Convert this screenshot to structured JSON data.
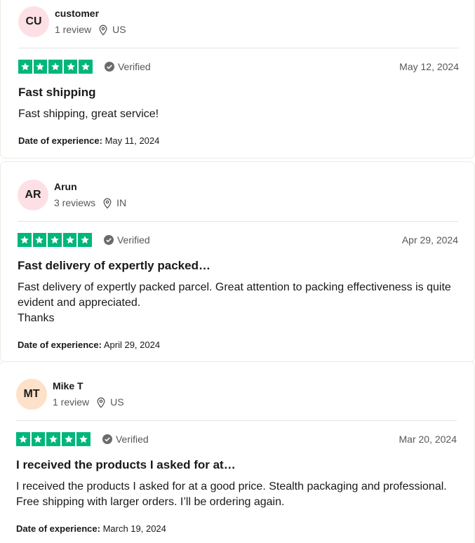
{
  "reviews": [
    {
      "initials": "CU",
      "avatar_color": "#fde0e6",
      "name": "customer",
      "review_count": "1 review",
      "country": "US",
      "verified_label": "Verified",
      "date": "May 12, 2024",
      "rating": 5,
      "title": "Fast shipping",
      "body": "Fast shipping, great service!",
      "experience_label": "Date of experience:",
      "experience_date": "May 11, 2024"
    },
    {
      "initials": "AR",
      "avatar_color": "#fde0e6",
      "name": "Arun",
      "review_count": "3 reviews",
      "country": "IN",
      "verified_label": "Verified",
      "date": "Apr 29, 2024",
      "rating": 5,
      "title": "Fast delivery of expertly packed…",
      "body": "Fast delivery of expertly packed parcel. Great attention to packing effectiveness is quite evident and appreciated.\nThanks",
      "experience_label": "Date of experience:",
      "experience_date": "April 29, 2024"
    },
    {
      "initials": "MT",
      "avatar_color": "#fde1c8",
      "name": "Mike T",
      "review_count": "1 review",
      "country": "US",
      "verified_label": "Verified",
      "date": "Mar 20, 2024",
      "rating": 5,
      "title": "I received the products I asked for at…",
      "body": "I received the products I asked for at a good price. Stealth packaging and professional. Free shipping with larger orders. I’ll be ordering again.",
      "experience_label": "Date of experience:",
      "experience_date": "March 19, 2024"
    }
  ],
  "colors": {
    "star_green": "#00b67a",
    "verified_gray": "#6b6b6b"
  },
  "icons": {
    "location": "location-pin-icon",
    "verified": "verified-check-icon",
    "star": "star-icon"
  }
}
